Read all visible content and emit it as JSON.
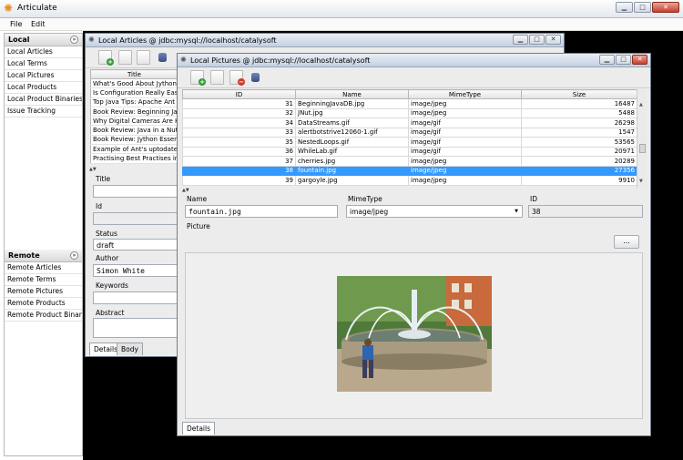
{
  "app": {
    "title": "Articulate",
    "logo_icon": "asterisk-logo"
  },
  "menu": [
    {
      "label": "File"
    },
    {
      "label": "Edit"
    }
  ],
  "local_section": {
    "header": "Local",
    "items": [
      "Local Articles",
      "Local Terms",
      "Local Pictures",
      "Local Products",
      "Local Product Binaries",
      "Issue Tracking"
    ]
  },
  "remote_section": {
    "header": "Remote",
    "items": [
      "Remote Articles",
      "Remote Terms",
      "Remote Pictures",
      "Remote Products",
      "Remote Product Binaries"
    ]
  },
  "articles_window": {
    "title": "Local Articles @ jdbc:mysql://localhost/catalysoft",
    "column": "Title",
    "rows": [
      "What's Good About Jython?",
      "Is Configuration Really Easier",
      "Top Java Tips: Apache Ant",
      "Book Review: Beginning Java",
      "Why Digital Cameras Are Here",
      "Book Review: Java in a Nutsh",
      "Book Review: Jython Essential",
      "Example of Ant's uptodate Ta",
      "Practising Best Practises in Yo"
    ],
    "labels": {
      "title": "Title",
      "id": "Id",
      "status": "Status",
      "author": "Author",
      "keywords": "Keywords",
      "abstract": "Abstract"
    },
    "values": {
      "status": "draft",
      "author": "Simon White"
    },
    "tabs": [
      "Details",
      "Body"
    ]
  },
  "pictures_window": {
    "title": "Local Pictures @ jdbc:mysql://localhost/catalysoft",
    "columns": [
      "ID",
      "Name",
      "MimeType",
      "Size"
    ],
    "rows": [
      {
        "id": "31",
        "name": "BeginningJavaDB.jpg",
        "mime": "image/jpeg",
        "size": "16487"
      },
      {
        "id": "32",
        "name": "JNut.jpg",
        "mime": "image/jpeg",
        "size": "5488"
      },
      {
        "id": "34",
        "name": "DataStreams.gif",
        "mime": "image/gif",
        "size": "26298"
      },
      {
        "id": "33",
        "name": "alertbotstrive12060-1.gif",
        "mime": "image/gif",
        "size": "1547"
      },
      {
        "id": "35",
        "name": "NestedLoops.gif",
        "mime": "image/gif",
        "size": "53565"
      },
      {
        "id": "36",
        "name": "WhileLab.gif",
        "mime": "image/gif",
        "size": "20971"
      },
      {
        "id": "37",
        "name": "cherries.jpg",
        "mime": "image/jpeg",
        "size": "20289"
      },
      {
        "id": "38",
        "name": "fountain.jpg",
        "mime": "image/jpeg",
        "size": "27356"
      },
      {
        "id": "39",
        "name": "gargoyle.jpg",
        "mime": "image/jpeg",
        "size": "9910"
      }
    ],
    "selected_row": 7,
    "labels": {
      "name": "Name",
      "mime": "MimeType",
      "id": "ID",
      "picture": "Picture"
    },
    "values": {
      "name": "fountain.jpg",
      "mime": "image/jpeg",
      "id": "38"
    },
    "browse_label": "...",
    "tabs": [
      "Details"
    ]
  },
  "icons": [
    "add-record-icon",
    "document-icon",
    "delete-record-icon",
    "database-icon",
    "chevron-down-icon",
    "minimize-icon",
    "maximize-icon",
    "close-icon"
  ],
  "colors": {
    "selection": "#3399ff",
    "desktop": "#000000",
    "add_badge": "#2e9c2e",
    "delete_badge": "#d33a2a"
  }
}
